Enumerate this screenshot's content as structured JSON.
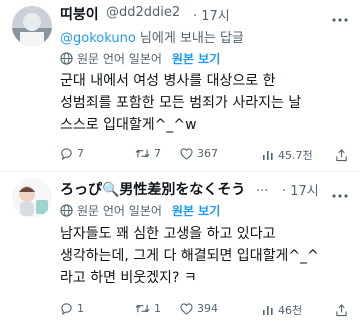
{
  "tweets": [
    {
      "display_name": "띠붕이",
      "handle": "@dd2ddie2",
      "time": "· 17시",
      "reply_to": {
        "mention": "@gokokuno",
        "suffix": " 님에게 보내는 답글"
      },
      "translate": {
        "label": "원문 언어 일본어",
        "show_original": "원본 보기"
      },
      "lines": [
        "군대 내에서 여성 병사를 대상으로 한",
        "성범죄를 포함한 모든 범죄가 사라지는 날",
        "스스로 입대할게^_^w"
      ],
      "stats": {
        "replies": "7",
        "retweets": "7",
        "likes": "367",
        "views": "45.7천"
      }
    },
    {
      "display_name": "ろっぴ🔍男性差別をなくそう",
      "handle": "...",
      "time": "· 17시",
      "translate": {
        "label": "원문 언어 일본어",
        "show_original": "원본 보기"
      },
      "lines": [
        "남자들도 꽤 심한 고생을 하고 있다고",
        "생각하는데, 그게 다 해결되면 입대할게^_^",
        "라고 하면 비웃겠지? ㅋ"
      ],
      "stats": {
        "replies": "1",
        "retweets": "1",
        "likes": "394",
        "views": "46천"
      }
    }
  ],
  "colors": {
    "accent": "#1d9bf0",
    "muted": "#536471"
  }
}
